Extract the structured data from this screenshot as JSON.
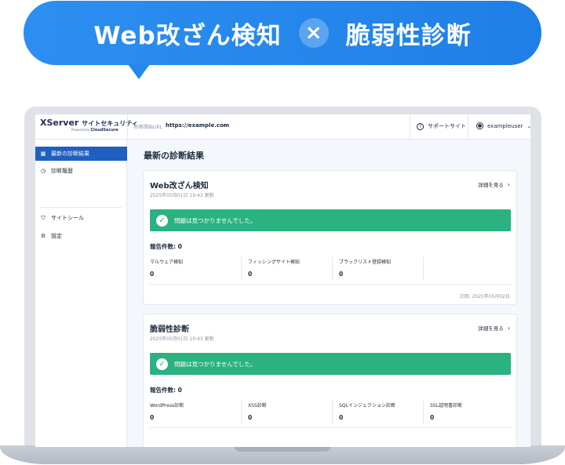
{
  "banner": {
    "left_text": "Web改ざん検知",
    "cross": "×",
    "right_text": "脆弱性診断"
  },
  "header": {
    "logo_main": "XServer",
    "logo_sub": "サイトセキュリティ",
    "logo_powered_prefix": "Powered by",
    "logo_powered_brand": "CloudSecure",
    "url_label": "診断開始URL",
    "url_value": "https://example.com",
    "support_label": "サポートサイト",
    "user_label": "exampleuser"
  },
  "sidebar": {
    "items": [
      {
        "label": "最新の診断結果",
        "icon": "grid-icon",
        "active": true
      },
      {
        "label": "診断履歴",
        "icon": "clock-icon",
        "active": false
      },
      {
        "label": "サイトシール",
        "icon": "shield-icon",
        "active": false
      },
      {
        "label": "設定",
        "icon": "gear-icon",
        "active": false
      }
    ]
  },
  "main": {
    "title": "最新の診断結果",
    "cards": [
      {
        "title": "Web改ざん検知",
        "date": "2025年05月01日 19:43 更新",
        "detail_link": "詳細を見る",
        "status": "問題は見つかりませんでした。",
        "count_label": "報告件数: 0",
        "metrics": [
          {
            "label": "マルウェア検知",
            "value": "0"
          },
          {
            "label": "フィッシングサイト検知",
            "value": "0"
          },
          {
            "label": "ブラックリスト登録検知",
            "value": "0"
          }
        ],
        "next_run": "次回: 2025年05月02日"
      },
      {
        "title": "脆弱性診断",
        "date": "2025年05月01日 19:43 更新",
        "detail_link": "詳細を見る",
        "status": "問題は見つかりませんでした。",
        "count_label": "報告件数: 0",
        "metrics": [
          {
            "label": "WordPress診断",
            "value": "0"
          },
          {
            "label": "XSS診断",
            "value": "0"
          },
          {
            "label": "SQLインジェクション診断",
            "value": "0"
          },
          {
            "label": "SSL証明書診断",
            "value": "0"
          }
        ]
      }
    ]
  }
}
